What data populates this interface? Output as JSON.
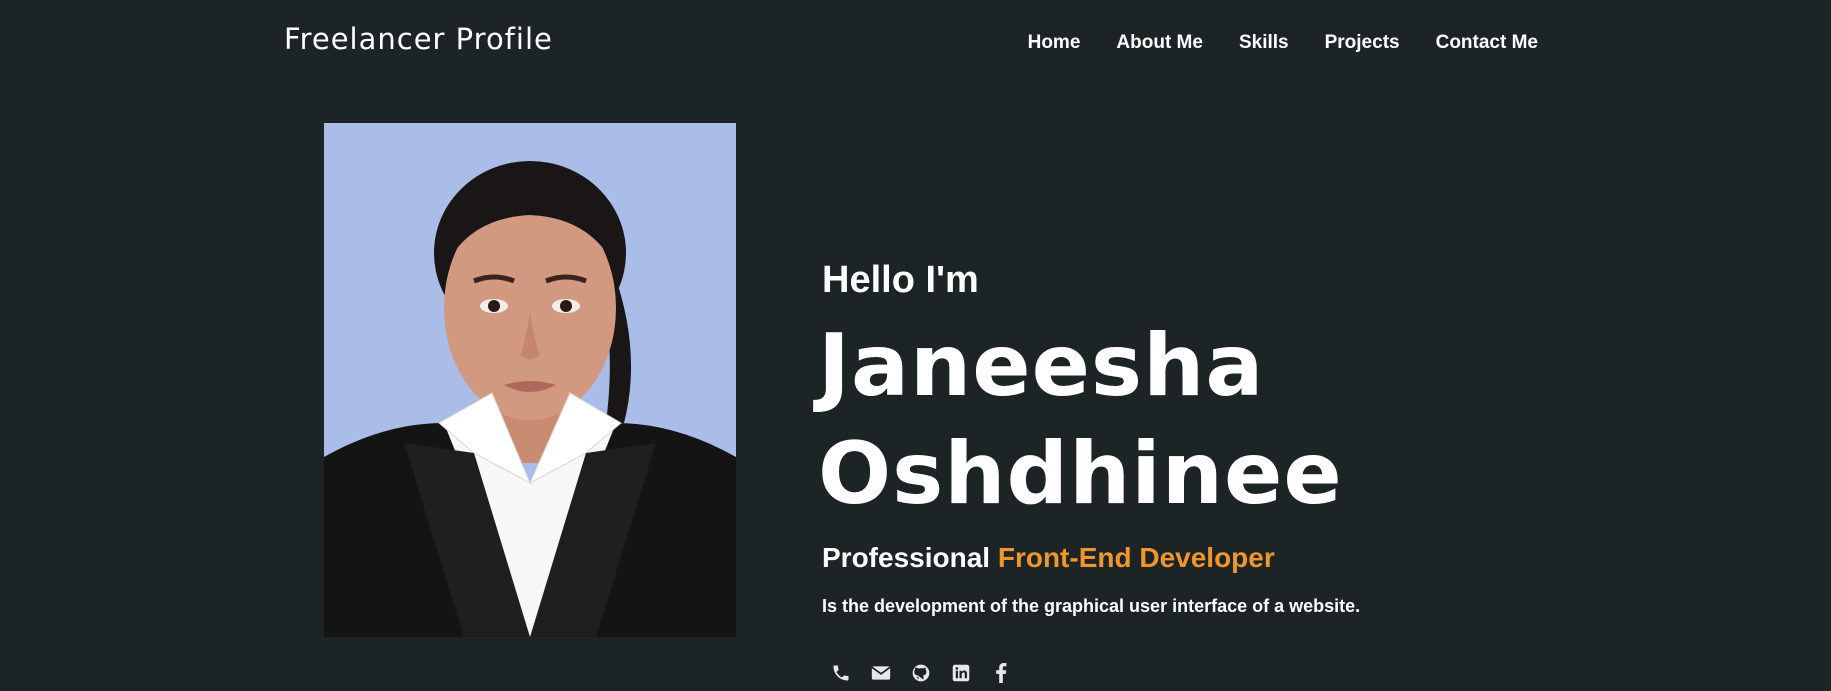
{
  "header": {
    "brand": "Freelancer Profile",
    "nav": [
      "Home",
      "About Me",
      "Skills",
      "Projects",
      "Contact Me"
    ]
  },
  "hero": {
    "greeting": "Hello I'm",
    "name_line1": "Janeesha",
    "name_line2": "Oshdhinee",
    "role_prefix": "Professional",
    "role_highlight": "Front-End Developer",
    "description": "Is the development of the graphical user interface of a website.",
    "accent_color": "#f0962c"
  },
  "socials": [
    "phone-icon",
    "email-icon",
    "github-icon",
    "linkedin-icon",
    "facebook-icon"
  ]
}
